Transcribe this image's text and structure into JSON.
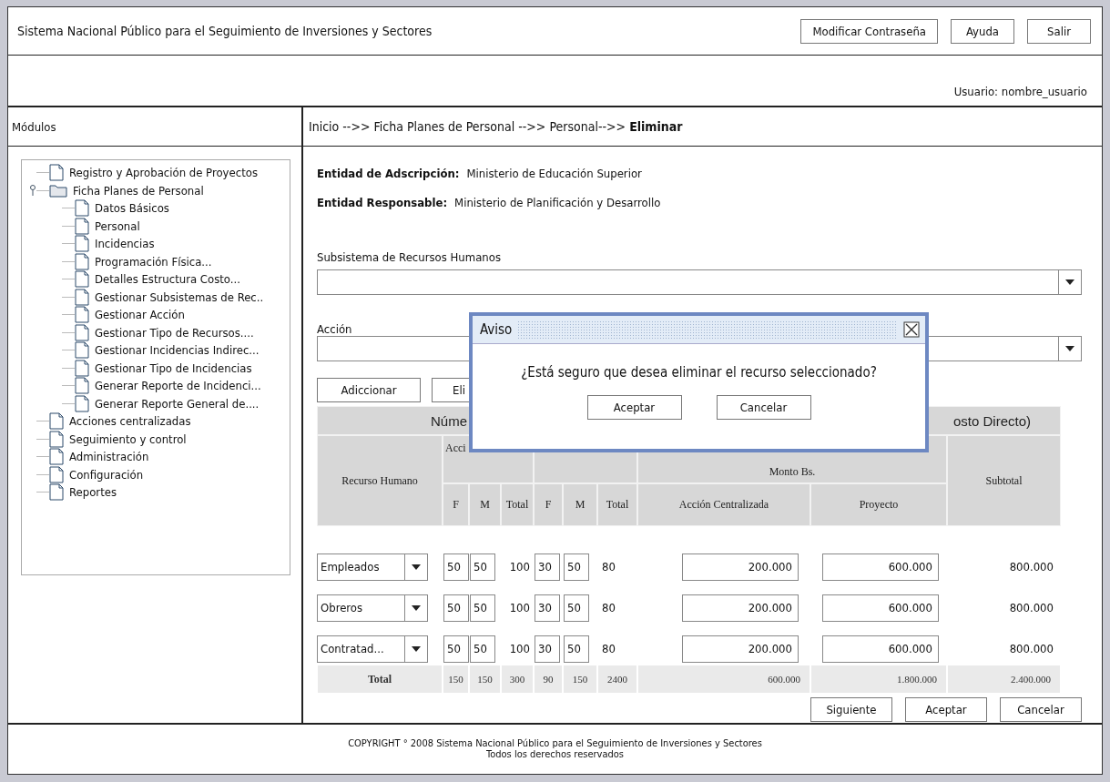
{
  "header": {
    "title": "Sistema Nacional Público para el Seguimiento de Inversiones y Sectores",
    "buttons": [
      "Modificar Contraseña",
      "Ayuda",
      "Salir"
    ]
  },
  "user_label": "Usuario: nombre_usuario",
  "sidebar": {
    "title": "Módulos",
    "items": [
      {
        "label": "Registro y Aprobación de Proyectos"
      },
      {
        "label": "Ficha Planes de Personal",
        "expanded": true,
        "children": [
          {
            "label": "Datos Básicos"
          },
          {
            "label": "Personal"
          },
          {
            "label": "Incidencias"
          },
          {
            "label": "Programación Física..."
          },
          {
            "label": "Detalles Estructura Costo..."
          },
          {
            "label": "Gestionar Subsistemas de Rec.."
          },
          {
            "label": "Gestionar Acción"
          },
          {
            "label": "Gestionar Tipo de Recursos...."
          },
          {
            "label": "Gestionar Incidencias Indirec..."
          },
          {
            "label": "Gestionar Tipo de Incidencias"
          },
          {
            "label": "Generar Reporte de Incidenci..."
          },
          {
            "label": "Generar Reporte General de...."
          }
        ]
      },
      {
        "label": "Acciones centralizadas"
      },
      {
        "label": "Seguimiento y control"
      },
      {
        "label": "Administración"
      },
      {
        "label": "Configuración"
      },
      {
        "label": "Reportes"
      }
    ]
  },
  "breadcrumb": "Inicio -->> Ficha Planes de Personal -->>  Personal-->> **Eliminar**",
  "entities": [
    {
      "label": "Entidad de Adscripción:",
      "value": "Ministerio de Educación Superior"
    },
    {
      "label": "Entidad Responsable:",
      "value": "Ministerio de Planificación y Desarrollo"
    }
  ],
  "selects": [
    {
      "label": "Subsistema de Recursos Humanos"
    },
    {
      "label": "Acción"
    }
  ],
  "action_buttons": [
    "Adiccionar",
    "Eli"
  ],
  "table": {
    "title_left": "Núme",
    "title_right": "osto Directo)",
    "group_left": "Acci",
    "group_monto": "Monto Bs.",
    "resource_header": "Recurso Humano",
    "subtotal_header": "Subtotal",
    "columns": [
      "F",
      "M",
      "Total",
      "F",
      "M",
      "Total",
      "Acción Centralizada",
      "Proyecto"
    ],
    "rows": [
      {
        "resource": "Empleados",
        "cells": [
          {
            "kind": "input",
            "text": "50"
          },
          {
            "kind": "input",
            "text": "50"
          },
          {
            "kind": "text",
            "text": "100"
          },
          {
            "kind": "input",
            "text": "30"
          },
          {
            "kind": "input",
            "text": "50"
          },
          {
            "kind": "text",
            "text": "80"
          },
          {
            "kind": "amount",
            "text": "200.000"
          },
          {
            "kind": "amount",
            "text": "600.000"
          },
          {
            "kind": "text",
            "text": "800.000"
          }
        ]
      },
      {
        "resource": "Obreros",
        "cells": [
          {
            "kind": "input",
            "text": "50"
          },
          {
            "kind": "input",
            "text": "50"
          },
          {
            "kind": "text",
            "text": "100"
          },
          {
            "kind": "input",
            "text": "30"
          },
          {
            "kind": "input",
            "text": "50"
          },
          {
            "kind": "text",
            "text": "80"
          },
          {
            "kind": "amount",
            "text": "200.000"
          },
          {
            "kind": "amount",
            "text": "600.000"
          },
          {
            "kind": "text",
            "text": "800.000"
          }
        ]
      },
      {
        "resource": "Contratad...",
        "cells": [
          {
            "kind": "input",
            "text": "50"
          },
          {
            "kind": "input",
            "text": "50"
          },
          {
            "kind": "text",
            "text": "100"
          },
          {
            "kind": "input",
            "text": "30"
          },
          {
            "kind": "input",
            "text": "50"
          },
          {
            "kind": "text",
            "text": "80"
          },
          {
            "kind": "amount",
            "text": "200.000"
          },
          {
            "kind": "amount",
            "text": "600.000"
          },
          {
            "kind": "text",
            "text": "800.000"
          }
        ]
      }
    ],
    "total": {
      "label": "Total",
      "cells": [
        "150",
        "150",
        "300",
        "90",
        "150",
        "2400",
        "600.000",
        "1.800.000",
        "2.400.000"
      ]
    }
  },
  "footer_buttons": [
    "Siguiente",
    "Aceptar",
    "Cancelar"
  ],
  "copyright": [
    "COPYRIGHT ° 2008 Sistema Nacional Público para el Seguimiento de Inversiones y Sectores",
    "Todos los derechos reservados"
  ],
  "dialog": {
    "title": "Aviso",
    "message": "¿Está seguro que desea eliminar el recurso seleccionado?",
    "buttons": [
      "Aceptar",
      "Cancelar"
    ]
  }
}
